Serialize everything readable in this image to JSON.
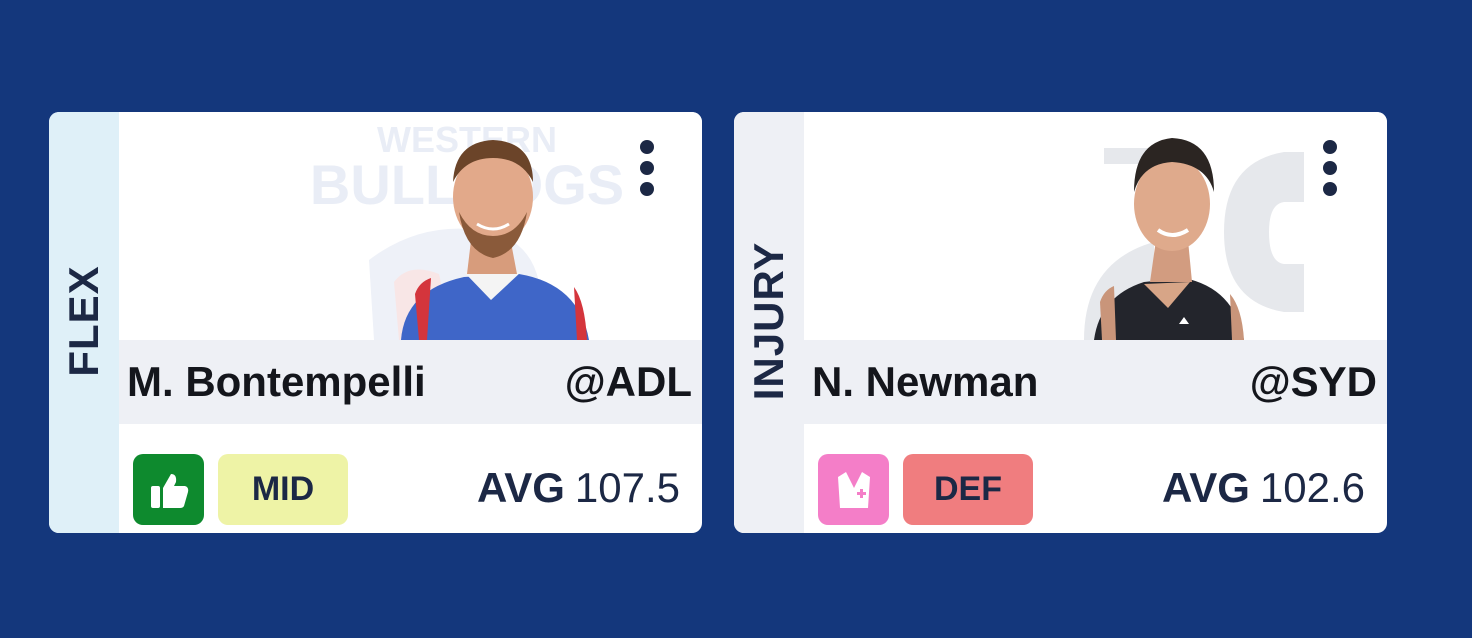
{
  "colors": {
    "background": "#14377c",
    "card": "#ffffff",
    "text_dark": "#1c2845",
    "thumbs_up_bg": "#0e8a2e",
    "mid_badge_bg": "#eef3a6",
    "injury_badge_bg": "#f47ec8",
    "def_badge_bg": "#f07d7f"
  },
  "players": [
    {
      "slot_label": "FLEX",
      "name": "M. Bontempelli",
      "opponent": "@ADL",
      "status_icon": "thumbs-up-icon",
      "position": "MID",
      "avg_label": "AVG",
      "avg_value": "107.5",
      "logo_text_1": "WESTERN",
      "logo_text_2": "BULLDOGS",
      "menu_icon": "kebab-menu-icon"
    },
    {
      "slot_label": "INJURY",
      "name": "N. Newman",
      "opponent": "@SYD",
      "status_icon": "injury-vest-icon",
      "position": "DEF",
      "avg_label": "AVG",
      "avg_value": "102.6",
      "menu_icon": "kebab-menu-icon"
    }
  ]
}
